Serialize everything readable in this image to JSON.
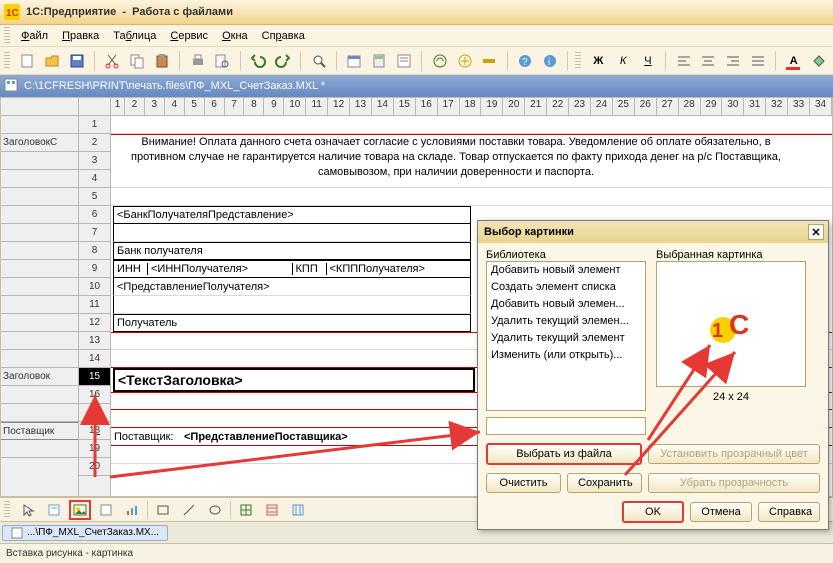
{
  "titlebar": {
    "app": "1С:Предприятие",
    "sub": "Работа с файлами"
  },
  "menu": {
    "file": "Файл",
    "edit": "Правка",
    "table": "Таблица",
    "service": "Сервис",
    "windows": "Окна",
    "help": "Справка"
  },
  "doc": {
    "path": "C:\\1CFRESH\\PRINT\\печать.files\\ПФ_MXL_СчетЗаказ.MXL *"
  },
  "ruler_numbers": [
    "1",
    "2",
    "3",
    "4",
    "5",
    "6",
    "7",
    "8",
    "9",
    "10",
    "11",
    "12",
    "13",
    "14",
    "15",
    "16",
    "17",
    "18",
    "19",
    "20",
    "21",
    "22",
    "23",
    "24",
    "25",
    "26",
    "27",
    "28",
    "29",
    "30",
    "31",
    "32",
    "33",
    "34"
  ],
  "side_labels": {
    "zagolovokS": "ЗаголовокС",
    "zagolovok": "Заголовок",
    "postavshik": "Поставщик"
  },
  "rows": {
    "r2_3_4": "Внимание! Оплата данного счета означает согласие с условиями поставки товара. Уведомление об оплате обязательно, в противном случае не гарантируется наличие товара на складе. Товар отпускается по факту прихода денег на р/с Поставщика, самовывозом, при наличии доверенности и паспорта.",
    "r6": "<БанкПолучателяПредставление>",
    "r8": "Банк получателя",
    "r9_inn": "ИНН",
    "r9_inn_val": "<ИННПолучателя>",
    "r9_kpp": "КПП",
    "r9_kpp_val": "<КПППолучателя>",
    "r10": "<ПредставлениеПолучателя>",
    "r12": "Получатель",
    "r15": "<ТекстЗаголовка>",
    "r18_lbl": "Поставщик:",
    "r18_val": "<ПредставлениеПоставщика>"
  },
  "row_numbers": [
    "1",
    "2",
    "3",
    "4",
    "5",
    "6",
    "7",
    "8",
    "9",
    "10",
    "11",
    "12",
    "13",
    "14",
    "15",
    "16",
    "17",
    "18",
    "19",
    "20"
  ],
  "dialog": {
    "title": "Выбор картинки",
    "lib_label": "Библиотека",
    "selected_label": "Выбранная картинка",
    "items": [
      "Добавить новый элемент",
      "Создать элемент списка",
      "Добавить новый элемен...",
      "Удалить текущий элемен...",
      "Удалить текущий элемент",
      "Изменить (или открыть)..."
    ],
    "dim": "24 x 24",
    "choose": "Выбрать из файла",
    "setTransparent": "Установить прозрачный цвет",
    "clear": "Очистить",
    "save": "Сохранить",
    "removeTransp": "Убрать прозрачность",
    "ok": "OK",
    "cancel": "Отмена",
    "help": "Справка"
  },
  "tasktab": "...\\ПФ_MXL_СчетЗаказ.MX...",
  "status": "Вставка рисунка - картинка"
}
